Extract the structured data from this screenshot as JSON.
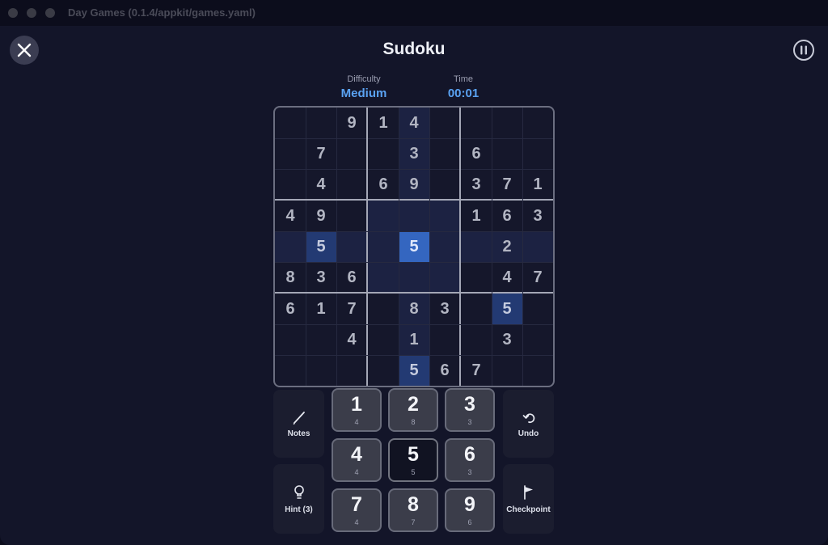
{
  "window": {
    "title": "Day Games (0.1.4/appkit/games.yaml)"
  },
  "header": {
    "title": "Sudoku",
    "close_icon": "close-icon",
    "pause_icon": "pause-icon"
  },
  "stats": {
    "difficulty_label": "Difficulty",
    "difficulty_value": "Medium",
    "time_label": "Time",
    "time_value": "00:01"
  },
  "board": {
    "selected": {
      "row": 4,
      "col": 4,
      "value": "5"
    },
    "rows": [
      [
        "",
        "",
        "9",
        "1",
        "4",
        "",
        "",
        "",
        ""
      ],
      [
        "",
        "7",
        "",
        "",
        "3",
        "",
        "6",
        "",
        ""
      ],
      [
        "",
        "4",
        "",
        "6",
        "9",
        "",
        "3",
        "7",
        "1"
      ],
      [
        "4",
        "9",
        "",
        "",
        "",
        "",
        "1",
        "6",
        "3"
      ],
      [
        "",
        "5",
        "",
        "",
        "5",
        "",
        "",
        "2",
        ""
      ],
      [
        "8",
        "3",
        "6",
        "",
        "",
        "",
        "",
        "4",
        "7"
      ],
      [
        "6",
        "1",
        "7",
        "",
        "8",
        "3",
        "",
        "5",
        ""
      ],
      [
        "",
        "",
        "4",
        "",
        "1",
        "",
        "",
        "3",
        ""
      ],
      [
        "",
        "",
        "",
        "",
        "5",
        "6",
        "7",
        "",
        ""
      ]
    ]
  },
  "controls": {
    "notes_label": "Notes",
    "hint_label": "Hint (3)",
    "undo_label": "Undo",
    "checkpoint_label": "Checkpoint",
    "notes_icon": "pencil-icon",
    "hint_icon": "lightbulb-icon",
    "undo_icon": "undo-icon",
    "checkpoint_icon": "flag-icon"
  },
  "numpad": [
    {
      "digit": "1",
      "count": "4"
    },
    {
      "digit": "2",
      "count": "8"
    },
    {
      "digit": "3",
      "count": "3"
    },
    {
      "digit": "4",
      "count": "4"
    },
    {
      "digit": "5",
      "count": "5"
    },
    {
      "digit": "6",
      "count": "3"
    },
    {
      "digit": "7",
      "count": "4"
    },
    {
      "digit": "8",
      "count": "7"
    },
    {
      "digit": "9",
      "count": "6"
    }
  ],
  "active_digit": "5",
  "colors": {
    "accent": "#5aa2f2",
    "selected_cell": "#3466c0",
    "same_digit": "#233a73"
  }
}
